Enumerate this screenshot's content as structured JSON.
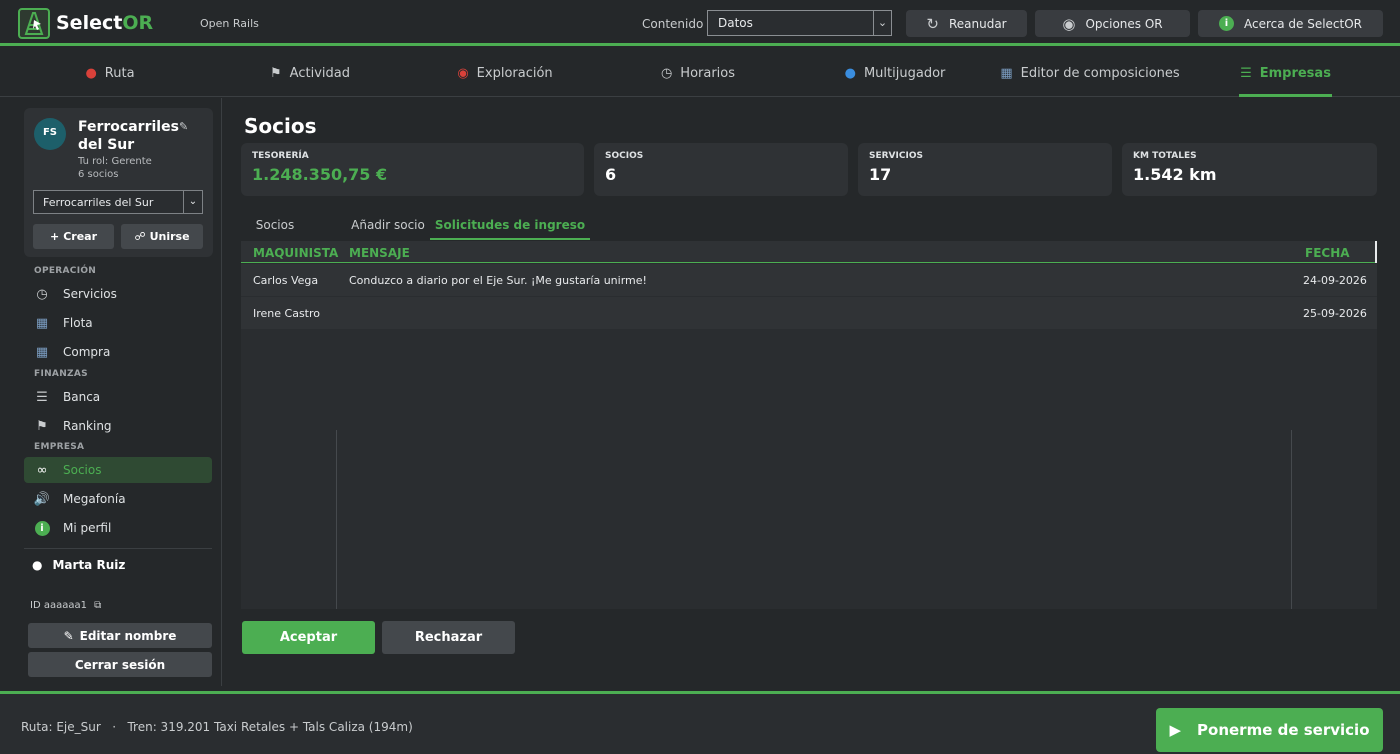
{
  "app": {
    "name_main": "Select",
    "name_accent": "OR",
    "subtitle": "Open Rails"
  },
  "header": {
    "content_label": "Contenido",
    "content_value": "Datos",
    "buttons": [
      {
        "label": "Reanudar",
        "icon": "resume-icon"
      },
      {
        "label": "Opciones OR",
        "icon": "settings-disc-icon"
      },
      {
        "label": "Acerca de SelectOR",
        "icon": "info-icon"
      }
    ]
  },
  "nav": {
    "tabs": [
      {
        "label": "Ruta",
        "icon": "map-pin-icon"
      },
      {
        "label": "Actividad",
        "icon": "flag-icon"
      },
      {
        "label": "Exploración",
        "icon": "compass-icon"
      },
      {
        "label": "Horarios",
        "icon": "clock-icon"
      },
      {
        "label": "Multijugador",
        "icon": "globe-icon"
      },
      {
        "label": "Editor de composiciones",
        "icon": "train-icon"
      },
      {
        "label": "Empresas",
        "icon": "bank-icon",
        "active": true
      }
    ]
  },
  "sidebar": {
    "company": {
      "initials": "FS",
      "name": "Ferrocarriles del Sur",
      "role": "Tu rol: Gerente",
      "members": "6 socios",
      "selected": "Ferrocarriles del Sur",
      "create_label": "Crear",
      "join_label": "Unirse"
    },
    "sections": [
      {
        "label": "OPERACIÓN",
        "items": [
          {
            "label": "Servicios",
            "icon": "clock-icon"
          },
          {
            "label": "Flota",
            "icon": "train-icon"
          },
          {
            "label": "Compra",
            "icon": "train-icon"
          }
        ]
      },
      {
        "label": "FINANZAS",
        "items": [
          {
            "label": "Banca",
            "icon": "bank-icon"
          },
          {
            "label": "Ranking",
            "icon": "checkered-flag-icon"
          }
        ]
      },
      {
        "label": "EMPRESA",
        "items": [
          {
            "label": "Socios",
            "icon": "link-icon",
            "active": true
          },
          {
            "label": "Megafonía",
            "icon": "speaker-icon"
          },
          {
            "label": "Mi perfil",
            "icon": "info-icon"
          }
        ]
      }
    ],
    "user": {
      "name": "Marta Ruiz",
      "id": "ID aaaaaa1",
      "edit_label": "Editar nombre",
      "logout_label": "Cerrar sesión"
    }
  },
  "main": {
    "title": "Socios",
    "stats": [
      {
        "label": "TESORERÍA",
        "value": "1.248.350,75 €",
        "accent": "#4cae52"
      },
      {
        "label": "SOCIOS",
        "value": "6"
      },
      {
        "label": "SERVICIOS",
        "value": "17"
      },
      {
        "label": "KM TOTALES",
        "value": "1.542 km"
      }
    ],
    "subtabs": [
      {
        "label": "Socios"
      },
      {
        "label": "Añadir socio"
      },
      {
        "label": "Solicitudes de ingreso",
        "active": true
      }
    ],
    "table": {
      "columns": [
        "MAQUINISTA",
        "MENSAJE",
        "FECHA"
      ],
      "rows": [
        {
          "driver": "Carlos Vega",
          "message": "Conduzco a diario por el Eje Sur. ¡Me gustaría unirme!",
          "date": "24-09-2026"
        },
        {
          "driver": "Irene Castro",
          "message": "",
          "date": "25-09-2026"
        }
      ]
    },
    "accept_label": "Aceptar",
    "reject_label": "Rechazar"
  },
  "footer": {
    "status": "Ruta: Eje_Sur   ·   Tren: 319.201 Taxi Retales + Tals Caliza (194m)",
    "start_label": "Ponerme de servicio"
  },
  "colors": {
    "accent": "#4cae52",
    "background": "#25282a",
    "panel": "#2f3235"
  }
}
